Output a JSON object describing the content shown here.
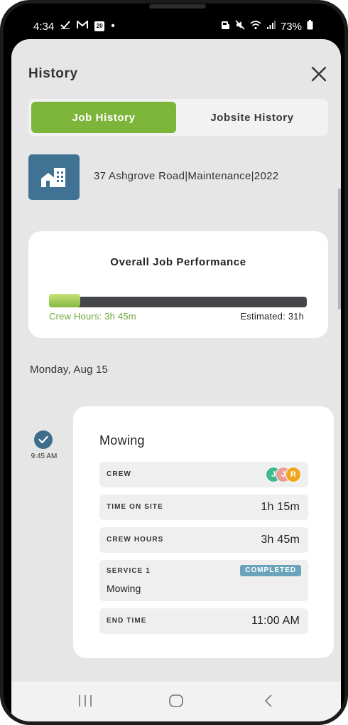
{
  "status_bar": {
    "time": "4:34",
    "left_icons": [
      "check-icon",
      "gmail-icon",
      "calendar-icon",
      "dot-icon"
    ],
    "calendar_day": "20",
    "battery": "73%",
    "right_icons": [
      "car-icon",
      "mute-icon",
      "wifi-icon",
      "signal-icon",
      "battery-icon"
    ]
  },
  "header": {
    "title": "History",
    "close_icon": "close-icon"
  },
  "tabs": [
    {
      "label": "Job History",
      "active": true
    },
    {
      "label": "Jobsite History",
      "active": false
    }
  ],
  "jobsite": {
    "icon": "building-icon",
    "name": "37 Ashgrove Road|Maintenance|2022"
  },
  "performance": {
    "title": "Overall Job Performance",
    "crew_hours_label": "Crew Hours: 3h 45m",
    "estimated_label": "Estimated: 31h",
    "progress_fraction": 0.121
  },
  "timeline": {
    "date": "Monday, Aug 15",
    "entries": [
      {
        "time": "9:45 AM",
        "title": "Mowing",
        "crew_label": "CREW",
        "crew": [
          {
            "initial": "J",
            "color": "#3fb98c"
          },
          {
            "initial": "J",
            "color": "#ea9f96"
          },
          {
            "initial": "R",
            "color": "#f2a51e"
          }
        ],
        "time_on_site_label": "TIME ON SITE",
        "time_on_site": "1h 15m",
        "crew_hours_label": "CREW HOURS",
        "crew_hours": "3h 45m",
        "service_label": "SERVICE 1",
        "service_status": "COMPLETED",
        "service_name": "Mowing",
        "end_time_label": "END TIME",
        "end_time": "11:00 AM"
      }
    ]
  },
  "nav_bar": {
    "recents_icon": "recents-icon",
    "home_icon": "home-icon",
    "back_icon": "back-icon"
  },
  "colors": {
    "accent_green": "#7db53a",
    "site_blue": "#3f7293",
    "check_blue": "#3f6e8a",
    "badge_blue": "#6aa4bb"
  }
}
